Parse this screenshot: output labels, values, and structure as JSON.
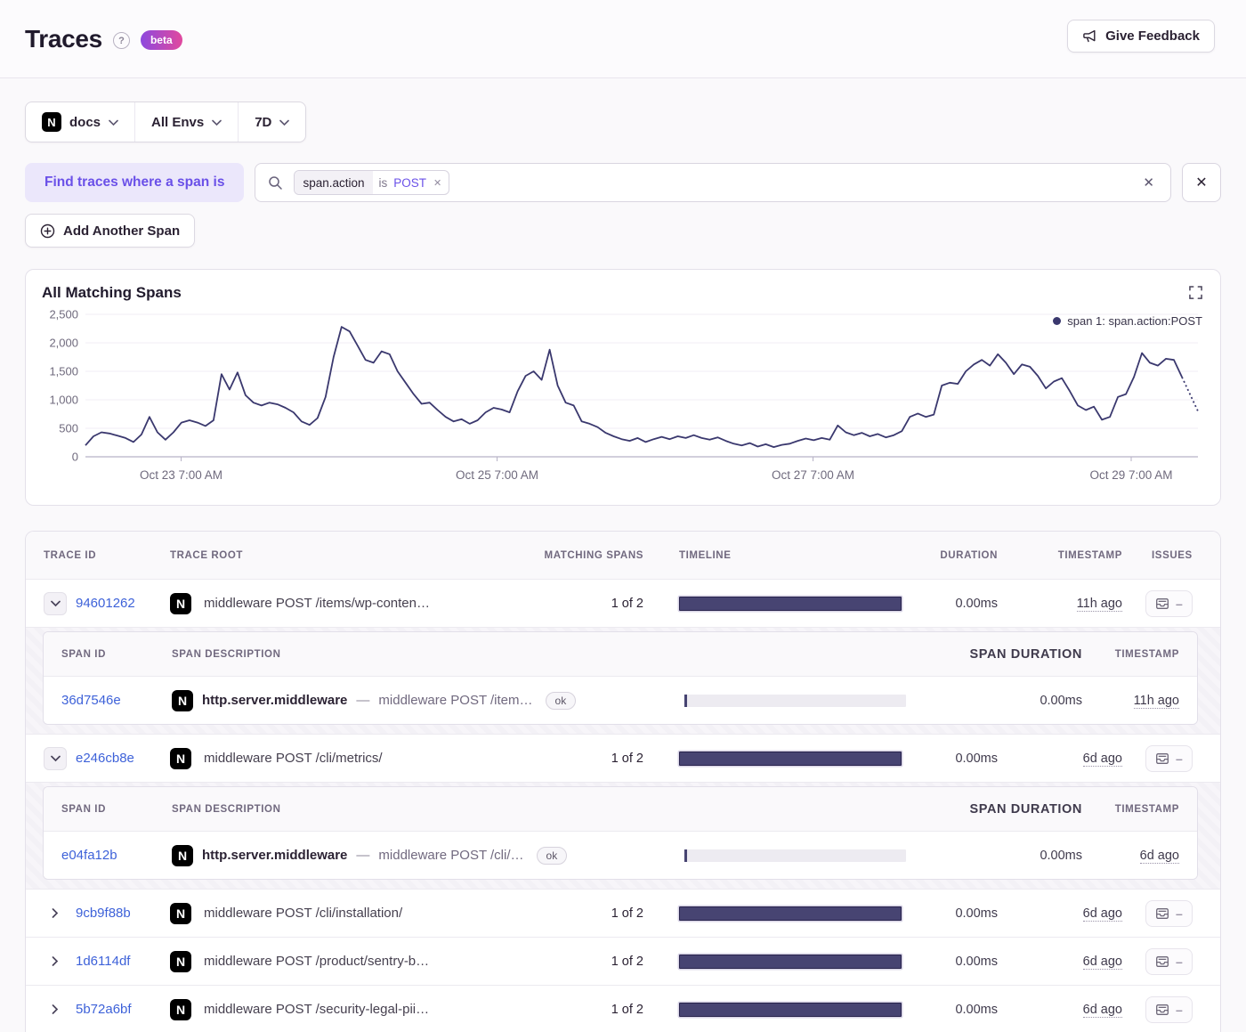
{
  "header": {
    "title": "Traces",
    "help_icon": "?",
    "beta_label": "beta",
    "feedback_label": "Give Feedback"
  },
  "icons": {
    "project_letter": "N",
    "close_glyph": "✕"
  },
  "colors": {
    "accent_purple": "#6a50e8",
    "link_blue": "#3e62d9",
    "series_line": "#3a386e",
    "timeline_bar": "#474472",
    "beta_gradient_start": "#8d49de",
    "beta_gradient_end": "#e1499e"
  },
  "filters": {
    "project_label": "docs",
    "env_label": "All Envs",
    "period_label": "7D"
  },
  "span_filter": {
    "label": "Find traces where a span is",
    "token": {
      "key": "span.action",
      "op": "is",
      "value": "POST"
    },
    "add_button_label": "Add Another Span"
  },
  "chart_data": {
    "type": "line",
    "title": "All Matching Spans",
    "legend": "span 1: span.action:POST",
    "series_color": "#3a386e",
    "ylim": [
      0,
      2500
    ],
    "ytick_values": [
      0,
      500,
      1000,
      1500,
      2000,
      2500
    ],
    "ytick_labels": [
      "0",
      "500",
      "1,000",
      "1,500",
      "2,000",
      "2,500"
    ],
    "xtick_labels": [
      "Oct 23 7:00 AM",
      "Oct 25 7:00 AM",
      "Oct 27 7:00 AM",
      "Oct 29 7:00 AM"
    ],
    "xtick_positions": [
      0.086,
      0.37,
      0.654,
      0.94
    ],
    "grid": true,
    "legend_position": "top-right",
    "dashed_tail_count": 3,
    "values": [
      200,
      360,
      430,
      410,
      370,
      330,
      260,
      390,
      700,
      430,
      300,
      430,
      600,
      640,
      600,
      540,
      640,
      1450,
      1180,
      1480,
      1080,
      950,
      900,
      950,
      920,
      860,
      780,
      620,
      560,
      680,
      1050,
      1750,
      2280,
      2200,
      1950,
      1700,
      1650,
      1850,
      1800,
      1500,
      1300,
      1100,
      930,
      950,
      820,
      700,
      620,
      660,
      580,
      640,
      780,
      860,
      830,
      780,
      1150,
      1420,
      1500,
      1350,
      1880,
      1250,
      950,
      900,
      620,
      580,
      520,
      420,
      360,
      310,
      280,
      330,
      260,
      310,
      350,
      310,
      360,
      330,
      380,
      330,
      300,
      340,
      280,
      230,
      200,
      240,
      180,
      220,
      170,
      210,
      230,
      280,
      320,
      290,
      330,
      300,
      550,
      430,
      380,
      420,
      360,
      400,
      340,
      380,
      450,
      700,
      760,
      700,
      740,
      1250,
      1300,
      1280,
      1500,
      1620,
      1700,
      1600,
      1800,
      1650,
      1450,
      1620,
      1580,
      1420,
      1200,
      1320,
      1380,
      1150,
      900,
      820,
      880,
      650,
      700,
      1050,
      1100,
      1400,
      1820,
      1650,
      1600,
      1720,
      1700,
      1400,
      1100,
      800
    ]
  },
  "trace_table": {
    "columns": [
      "TRACE ID",
      "TRACE ROOT",
      "MATCHING SPANS",
      "TIMELINE",
      "DURATION",
      "TIMESTAMP",
      "ISSUES"
    ],
    "span_columns": [
      "SPAN ID",
      "SPAN DESCRIPTION",
      "SPAN DURATION",
      "TIMESTAMP"
    ],
    "op_separator": "—",
    "rows": [
      {
        "trace_id": "94601262",
        "root": "middleware POST /items/wp-conten…",
        "matching": "1 of 2",
        "duration": "0.00ms",
        "timestamp": "11h ago",
        "issues": "–",
        "spans": [
          {
            "span_id": "36d7546e",
            "op": "http.server.middleware",
            "description": "middleware POST /item…",
            "status": "ok",
            "duration": "0.00ms",
            "timestamp": "11h ago"
          }
        ]
      },
      {
        "trace_id": "e246cb8e",
        "root": "middleware POST /cli/metrics/",
        "matching": "1 of 2",
        "duration": "0.00ms",
        "timestamp": "6d ago",
        "issues": "–",
        "spans": [
          {
            "span_id": "e04fa12b",
            "op": "http.server.middleware",
            "description": "middleware POST /cli/…",
            "status": "ok",
            "duration": "0.00ms",
            "timestamp": "6d ago"
          }
        ]
      },
      {
        "trace_id": "9cb9f88b",
        "root": "middleware POST /cli/installation/",
        "matching": "1 of 2",
        "duration": "0.00ms",
        "timestamp": "6d ago",
        "issues": "–",
        "spans": []
      },
      {
        "trace_id": "1d6114df",
        "root": "middleware POST /product/sentry-b…",
        "matching": "1 of 2",
        "duration": "0.00ms",
        "timestamp": "6d ago",
        "issues": "–",
        "spans": []
      },
      {
        "trace_id": "5b72a6bf",
        "root": "middleware POST /security-legal-pii…",
        "matching": "1 of 2",
        "duration": "0.00ms",
        "timestamp": "6d ago",
        "issues": "–",
        "spans": []
      }
    ]
  }
}
